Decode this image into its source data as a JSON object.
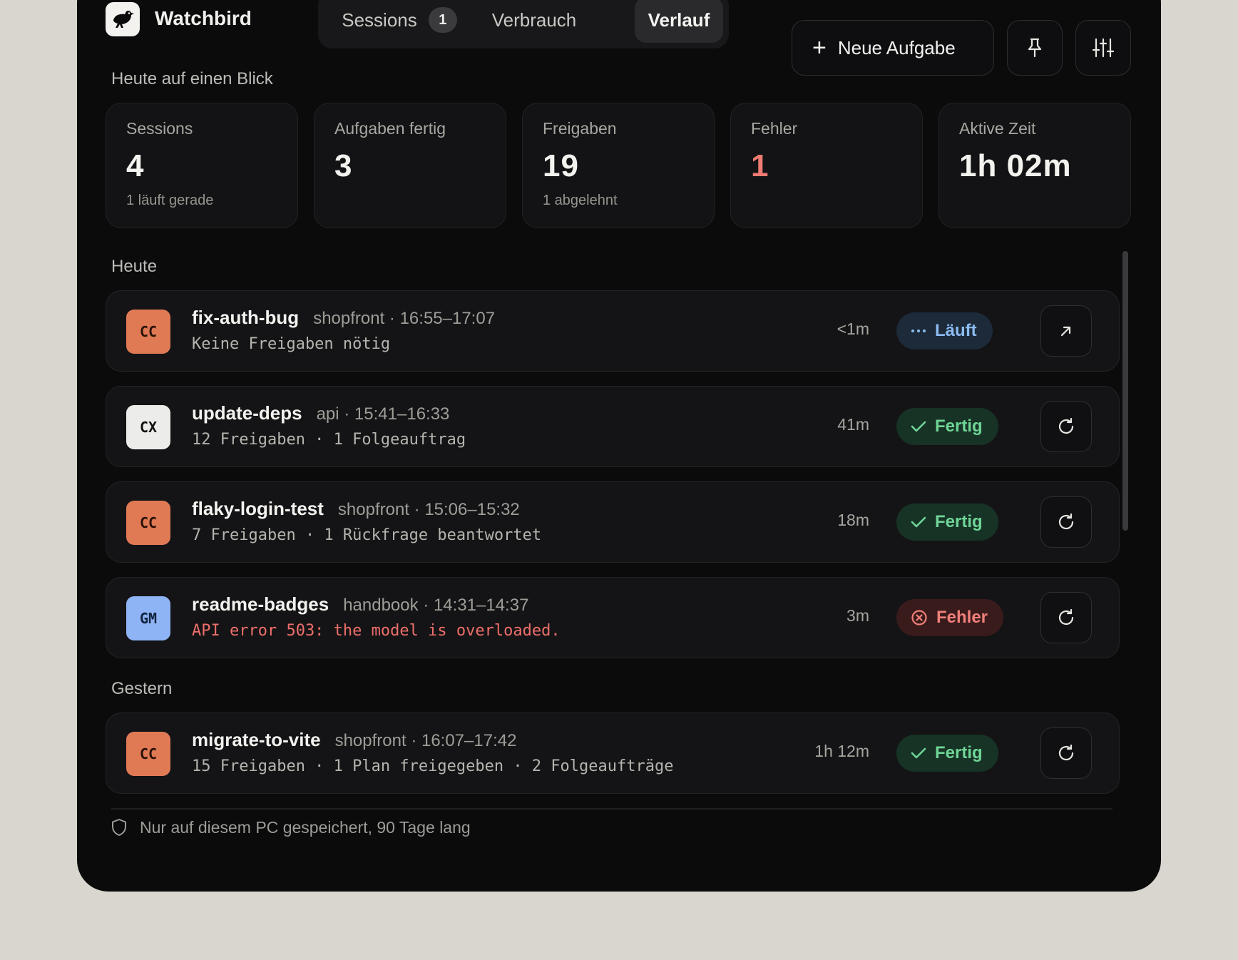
{
  "app": {
    "name": "Watchbird"
  },
  "tabs": [
    {
      "label": "Sessions",
      "badge": "1"
    },
    {
      "label": "Verbrauch"
    },
    {
      "label": "Verlauf"
    }
  ],
  "toolbar": {
    "new_task_label": "Neue Aufgabe"
  },
  "overview": {
    "heading": "Heute auf einen Blick",
    "stats": [
      {
        "label": "Sessions",
        "value": "4",
        "sub": "1 läuft gerade"
      },
      {
        "label": "Aufgaben fertig",
        "value": "3"
      },
      {
        "label": "Freigaben",
        "value": "19",
        "sub": "1 abgelehnt"
      },
      {
        "label": "Fehler",
        "value": "1"
      },
      {
        "label": "Aktive Zeit",
        "value": "1h 02m"
      }
    ]
  },
  "groups": [
    {
      "heading": "Heute",
      "rows": [
        {
          "avatar": "CC",
          "title": "fix-auth-bug",
          "meta": "shopfront · 16:55–17:07",
          "desc": "Keine Freigaben nötig",
          "duration": "<1m",
          "status": "Läuft"
        },
        {
          "avatar": "CX",
          "title": "update-deps",
          "meta": "api · 15:41–16:33",
          "desc": "12 Freigaben · 1 Folgeauftrag",
          "duration": "41m",
          "status": "Fertig"
        },
        {
          "avatar": "CC",
          "title": "flaky-login-test",
          "meta": "shopfront · 15:06–15:32",
          "desc": "7 Freigaben · 1 Rückfrage beantwortet",
          "duration": "18m",
          "status": "Fertig"
        },
        {
          "avatar": "GM",
          "title": "readme-badges",
          "meta": "handbook · 14:31–14:37",
          "desc": "API error 503: the model is overloaded.",
          "duration": "3m",
          "status": "Fehler"
        }
      ]
    },
    {
      "heading": "Gestern",
      "rows": [
        {
          "avatar": "CC",
          "title": "migrate-to-vite",
          "meta": "shopfront · 16:07–17:42",
          "desc": "15 Freigaben · 1 Plan freigegeben · 2 Folgeaufträge",
          "duration": "1h 12m",
          "status": "Fertig"
        }
      ]
    }
  ],
  "footer": {
    "text": "Nur auf diesem PC gespeichert, 90 Tage lang"
  },
  "colors": {
    "avatar_cc": "#e07a55",
    "avatar_cx": "#ececea",
    "avatar_gm": "#8fb4f5",
    "status_running": "#8cbcf2",
    "status_done": "#6fd596",
    "status_error": "#f08079"
  },
  "icons": [
    "bird-logo-icon",
    "plus-icon",
    "pin-icon",
    "sliders-icon",
    "more-dots-icon",
    "check-icon",
    "error-circle-icon",
    "open-external-icon",
    "refresh-icon",
    "shield-icon"
  ]
}
